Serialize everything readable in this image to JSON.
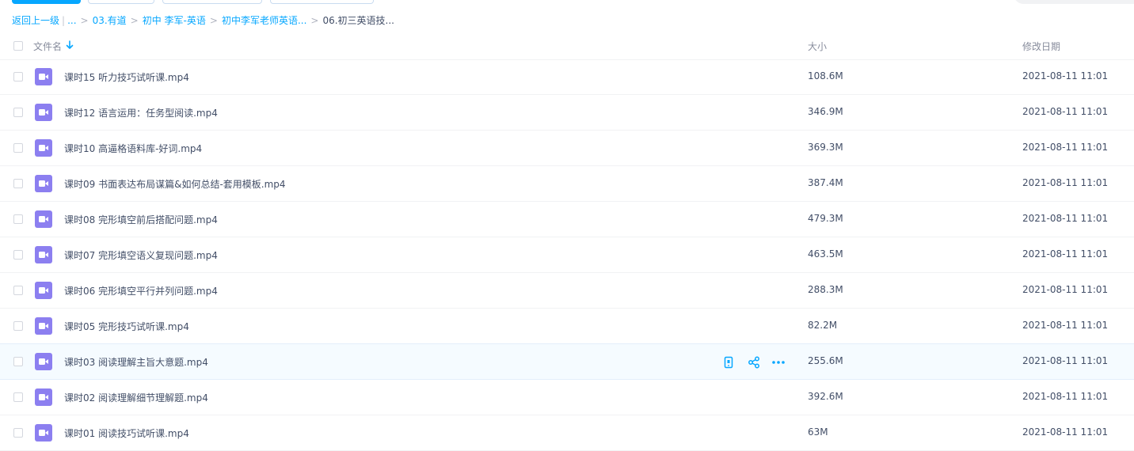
{
  "breadcrumb": {
    "back": "返回上一级",
    "pipe": "|",
    "ellipsis": "...",
    "items": [
      "03.有道",
      "初中 李军-英语",
      "初中李军老师英语..."
    ],
    "current": "06.初三英语技..."
  },
  "header": {
    "name": "文件名",
    "size": "大小",
    "date": "修改日期"
  },
  "files": [
    {
      "name": "课时15 听力技巧试听课.mp4",
      "size": "108.6M",
      "date": "2021-08-11 11:01"
    },
    {
      "name": "课时12 语言运用：任务型阅读.mp4",
      "size": "346.9M",
      "date": "2021-08-11 11:01"
    },
    {
      "name": "课时10 高逼格语料库-好词.mp4",
      "size": "369.3M",
      "date": "2021-08-11 11:01"
    },
    {
      "name": "课时09 书面表达布局谋篇&如何总结-套用模板.mp4",
      "size": "387.4M",
      "date": "2021-08-11 11:01"
    },
    {
      "name": "课时08 完形填空前后搭配问题.mp4",
      "size": "479.3M",
      "date": "2021-08-11 11:01"
    },
    {
      "name": "课时07 完形填空语义复现问题.mp4",
      "size": "463.5M",
      "date": "2021-08-11 11:01"
    },
    {
      "name": "课时06 完形填空平行并列问题.mp4",
      "size": "288.3M",
      "date": "2021-08-11 11:01"
    },
    {
      "name": "课时05 完形技巧试听课.mp4",
      "size": "82.2M",
      "date": "2021-08-11 11:01"
    },
    {
      "name": "课时03 阅读理解主旨大意题.mp4",
      "size": "255.6M",
      "date": "2021-08-11 11:01"
    },
    {
      "name": "课时02 阅读理解细节理解题.mp4",
      "size": "392.6M",
      "date": "2021-08-11 11:01"
    },
    {
      "name": "课时01 阅读技巧试听课.mp4",
      "size": "63M",
      "date": "2021-08-11 11:01"
    }
  ],
  "icons": {
    "file": "video-file-icon",
    "sort": "sort-down-arrow-icon",
    "actions": [
      "phone-icon",
      "share-icon",
      "more-icon"
    ]
  },
  "colors": {
    "accent": "#06a7ff",
    "file_icon": "#8c7ff0",
    "text": "#424e67",
    "muted": "#878c9c",
    "hover_row": "#f5fbff"
  }
}
